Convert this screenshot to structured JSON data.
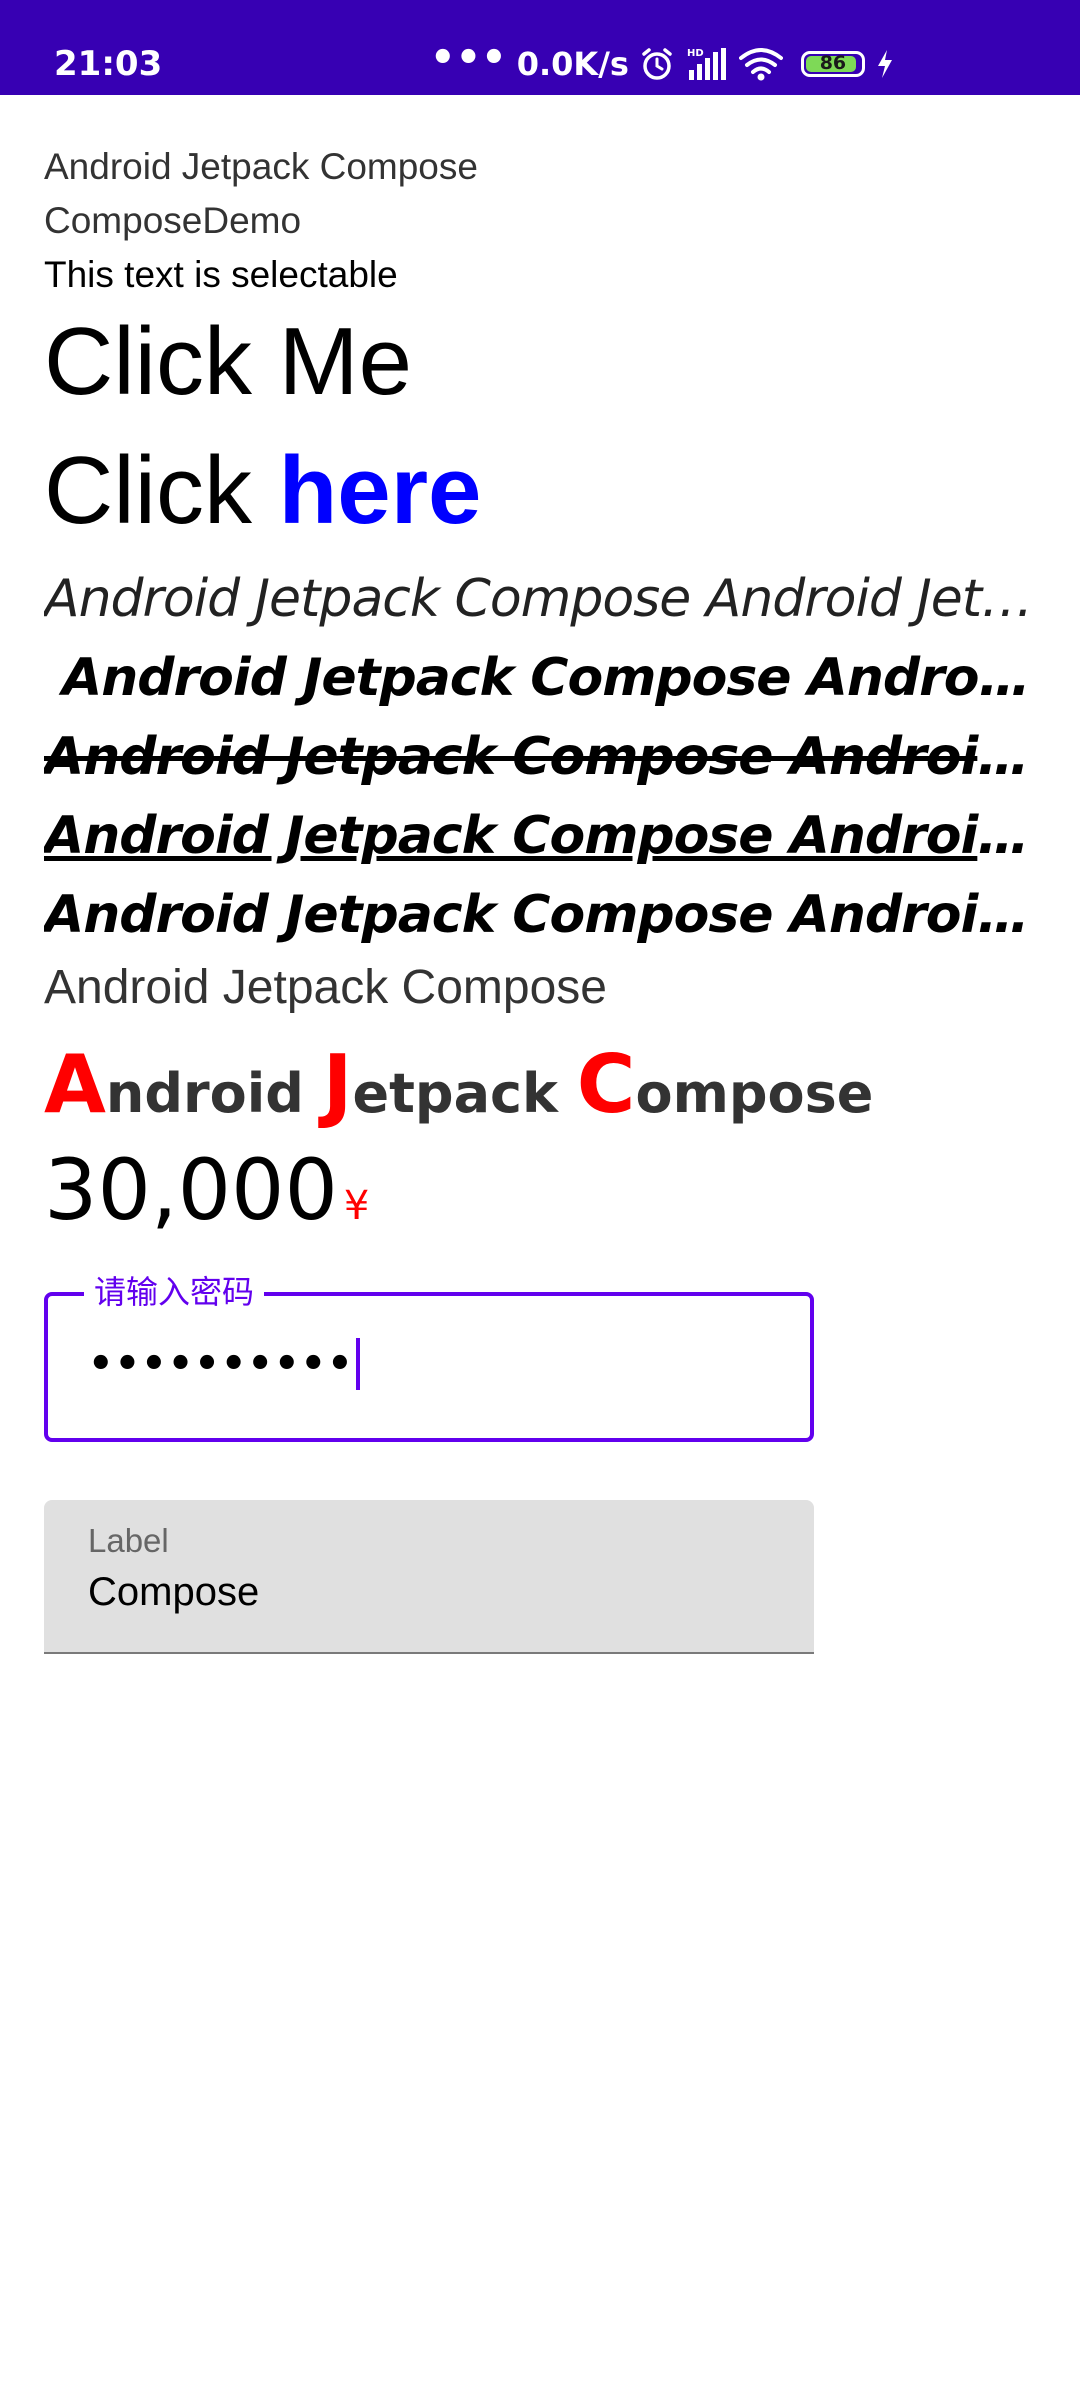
{
  "status_bar": {
    "time": "21:03",
    "dots": "•••",
    "network_speed": "0.0K/s",
    "battery_level": "86",
    "icons": [
      "alarm-icon",
      "signal-hd-icon",
      "wifi-icon",
      "battery-icon",
      "charging-icon"
    ],
    "background_color": "#3700B3"
  },
  "texts": {
    "line1": "Android Jetpack Compose",
    "line2": "ComposeDemo",
    "selectable": "This text is selectable",
    "click_me": "Click Me",
    "click_prefix": "Click ",
    "click_here": "here",
    "styled_lines": [
      "Android Jetpack Compose Android Jetpack Compose",
      "Android Jetpack Compose Android Jetpack Compose",
      "Android Jetpack Compose Android Jetpack Compose",
      "Android Jetpack Compose Android Jetpack Compose",
      "Android Jetpack Compose Android Jetpack Compose"
    ],
    "plain": "Android Jetpack Compose",
    "rich": {
      "a_cap": "A",
      "a_rest": "ndroid ",
      "j_cap": "J",
      "j_rest": "etpack ",
      "c_cap": "C",
      "c_rest": "ompose"
    },
    "price": {
      "amount": "30,000",
      "currency": "¥"
    }
  },
  "password_field": {
    "label": "请输入密码",
    "value": "••••••••••",
    "accent_color": "#6200EE"
  },
  "filled_field": {
    "label": "Label",
    "value": "Compose"
  },
  "colors": {
    "link_blue": "#0000FF",
    "highlight_red": "#FF0000"
  }
}
